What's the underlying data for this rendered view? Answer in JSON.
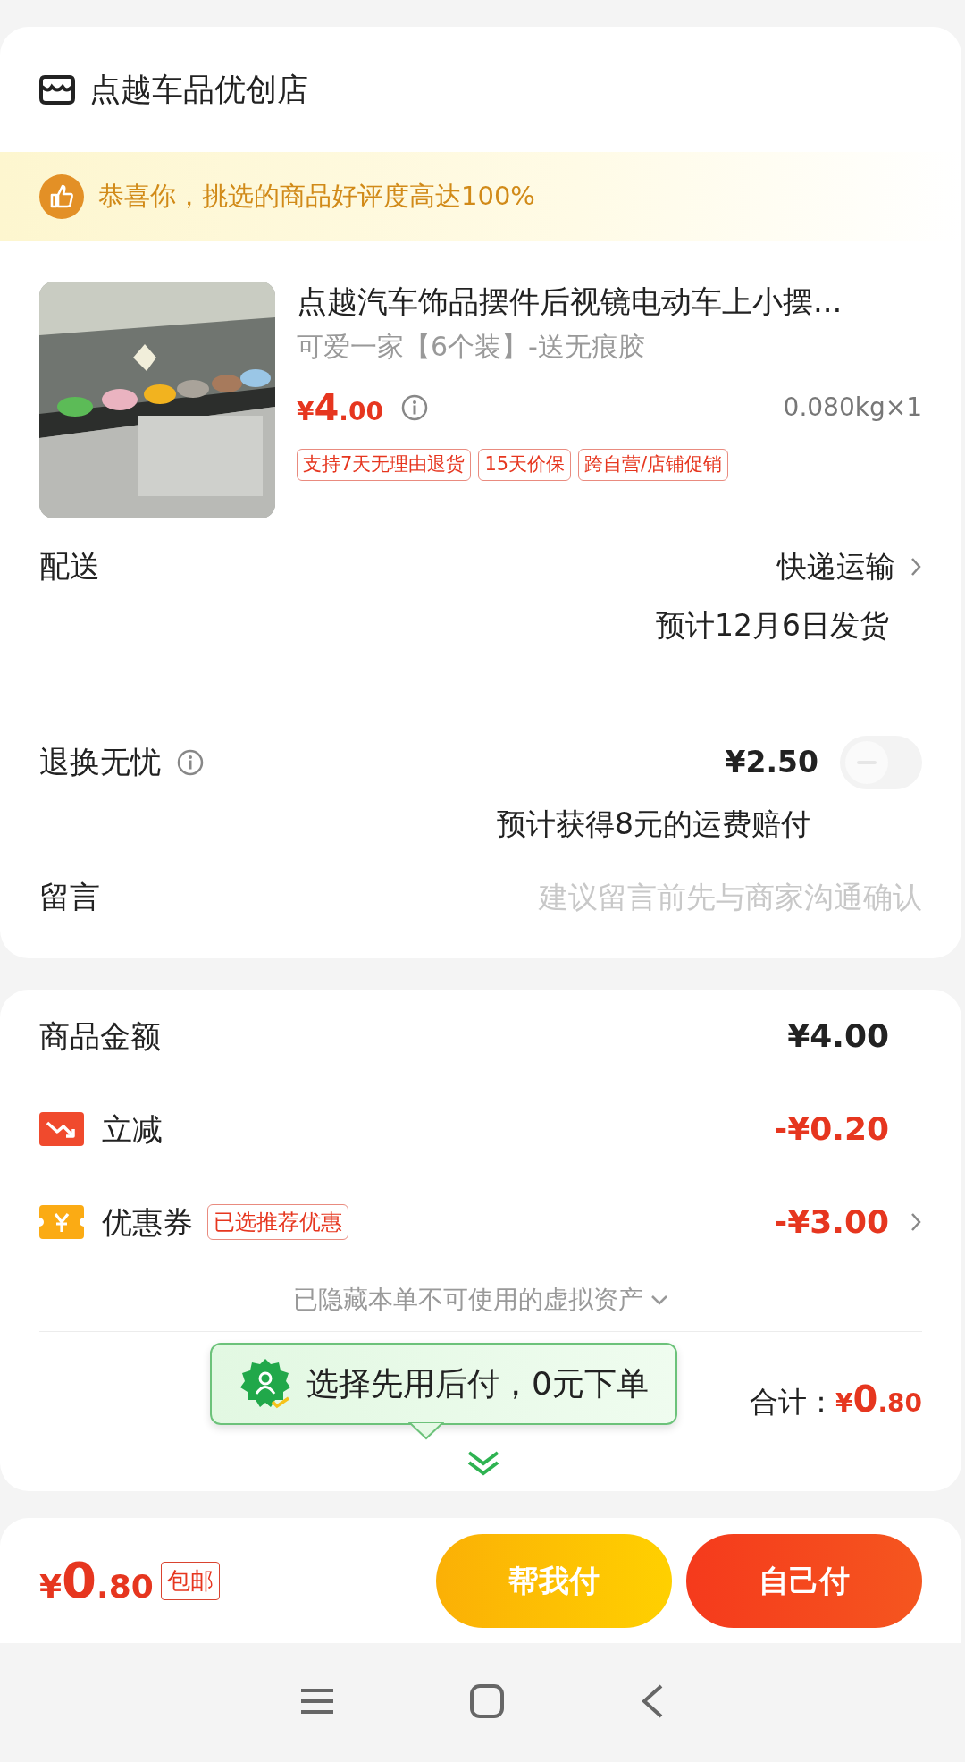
{
  "store": {
    "name": "点越车品优创店"
  },
  "banner": {
    "text": "恭喜你，挑选的商品好评度高达100%"
  },
  "product": {
    "title": "点越汽车饰品摆件后视镜电动车上小摆...",
    "variant": "可爱一家【6个装】-送无痕胶",
    "price": "¥4.00",
    "weight_qty": "0.080kg×1",
    "tags": [
      "支持7天无理由退货",
      "15天价保",
      "跨自营/店铺促销"
    ]
  },
  "delivery": {
    "label": "配送",
    "method": "快递运输",
    "estimate": "预计12月6日发货"
  },
  "return_insurance": {
    "label": "退换无忧",
    "price": "¥2.50",
    "on": false,
    "note": "预计获得8元的运费赔付"
  },
  "message": {
    "label": "留言",
    "placeholder": "建议留言前先与商家沟通确认"
  },
  "summary": {
    "rows": [
      {
        "kind": "plain",
        "label": "商品金额",
        "amount": "¥4.00"
      },
      {
        "kind": "discount",
        "label": "立减",
        "amount": "-¥0.20"
      },
      {
        "kind": "coupon",
        "label": "优惠券",
        "tag": "已选推荐优惠",
        "amount": "-¥3.00"
      }
    ],
    "hidden_assets": "已隐藏本单不可使用的虚拟资产",
    "total_label": "合计：",
    "total": "¥0.80"
  },
  "tooltip": {
    "text": "选择先用后付，0元下单"
  },
  "footer": {
    "total": "¥0.80",
    "tag": "包邮",
    "buttons": [
      {
        "kind": "secondary",
        "label": "帮我付"
      },
      {
        "kind": "primary",
        "label": "自己付"
      }
    ]
  }
}
